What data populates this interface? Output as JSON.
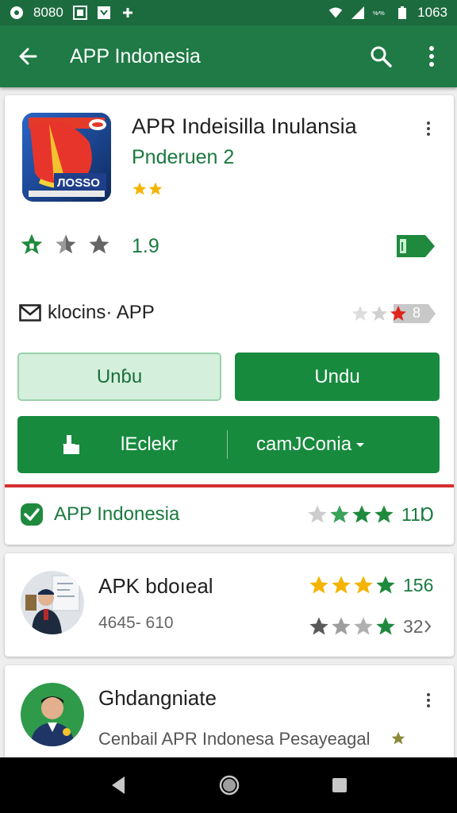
{
  "status_bar": {
    "time_left": "8080",
    "battery": "1063"
  },
  "app_bar": {
    "title": "APP Indonesia"
  },
  "app": {
    "name": "APR Indeisilla Inulansia",
    "developer": "Pnderuen 2",
    "rating": "1.9",
    "info_label": "klocins· APP",
    "badge_text": "8"
  },
  "buttons": {
    "install_outline": "Unɓu",
    "install_solid": "Undu",
    "wide_label_1": "lEclekr",
    "wide_label_2": "camJConia"
  },
  "verified": {
    "label": "APP Indonesia",
    "count": "11Ɒ"
  },
  "list": [
    {
      "title": "APK bdoıeal",
      "subtitle": "4645- 610",
      "count_1": "156",
      "count_2": "32"
    },
    {
      "title": "Ghdangniate",
      "subtitle": "Cenbail APR Indonesa Pesayeagal"
    }
  ],
  "colors": {
    "primary": "#1f7a45",
    "accent": "#178a3e",
    "star": "#f4b400",
    "danger": "#d32f2f"
  }
}
